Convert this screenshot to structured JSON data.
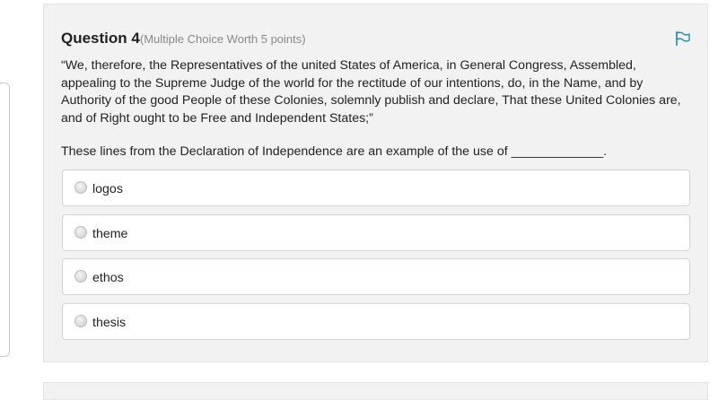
{
  "question": {
    "number_label": "Question 4",
    "worth_label": "(Multiple Choice Worth 5 points)",
    "quote": "“We, therefore, the Representatives of the united States of America, in General Congress, Assembled, appealing to the Supreme Judge of the world for the rectitude of our intentions, do, in the Name, and by Authority of the good People of these Colonies, solemnly publish and declare, That these United Colonies are, and of Right ought to be Free and Independent States;”",
    "prompt": "These lines from the Declaration of Independence are an example of the use of _____________.",
    "flag_icon": "flag-icon",
    "options": [
      {
        "label": "logos"
      },
      {
        "label": "theme"
      },
      {
        "label": "ethos"
      },
      {
        "label": "thesis"
      }
    ]
  },
  "colors": {
    "card_bg": "#f2f2f2",
    "flag": "#1f8fb5",
    "text": "#222222",
    "muted": "#8a8a8a"
  }
}
